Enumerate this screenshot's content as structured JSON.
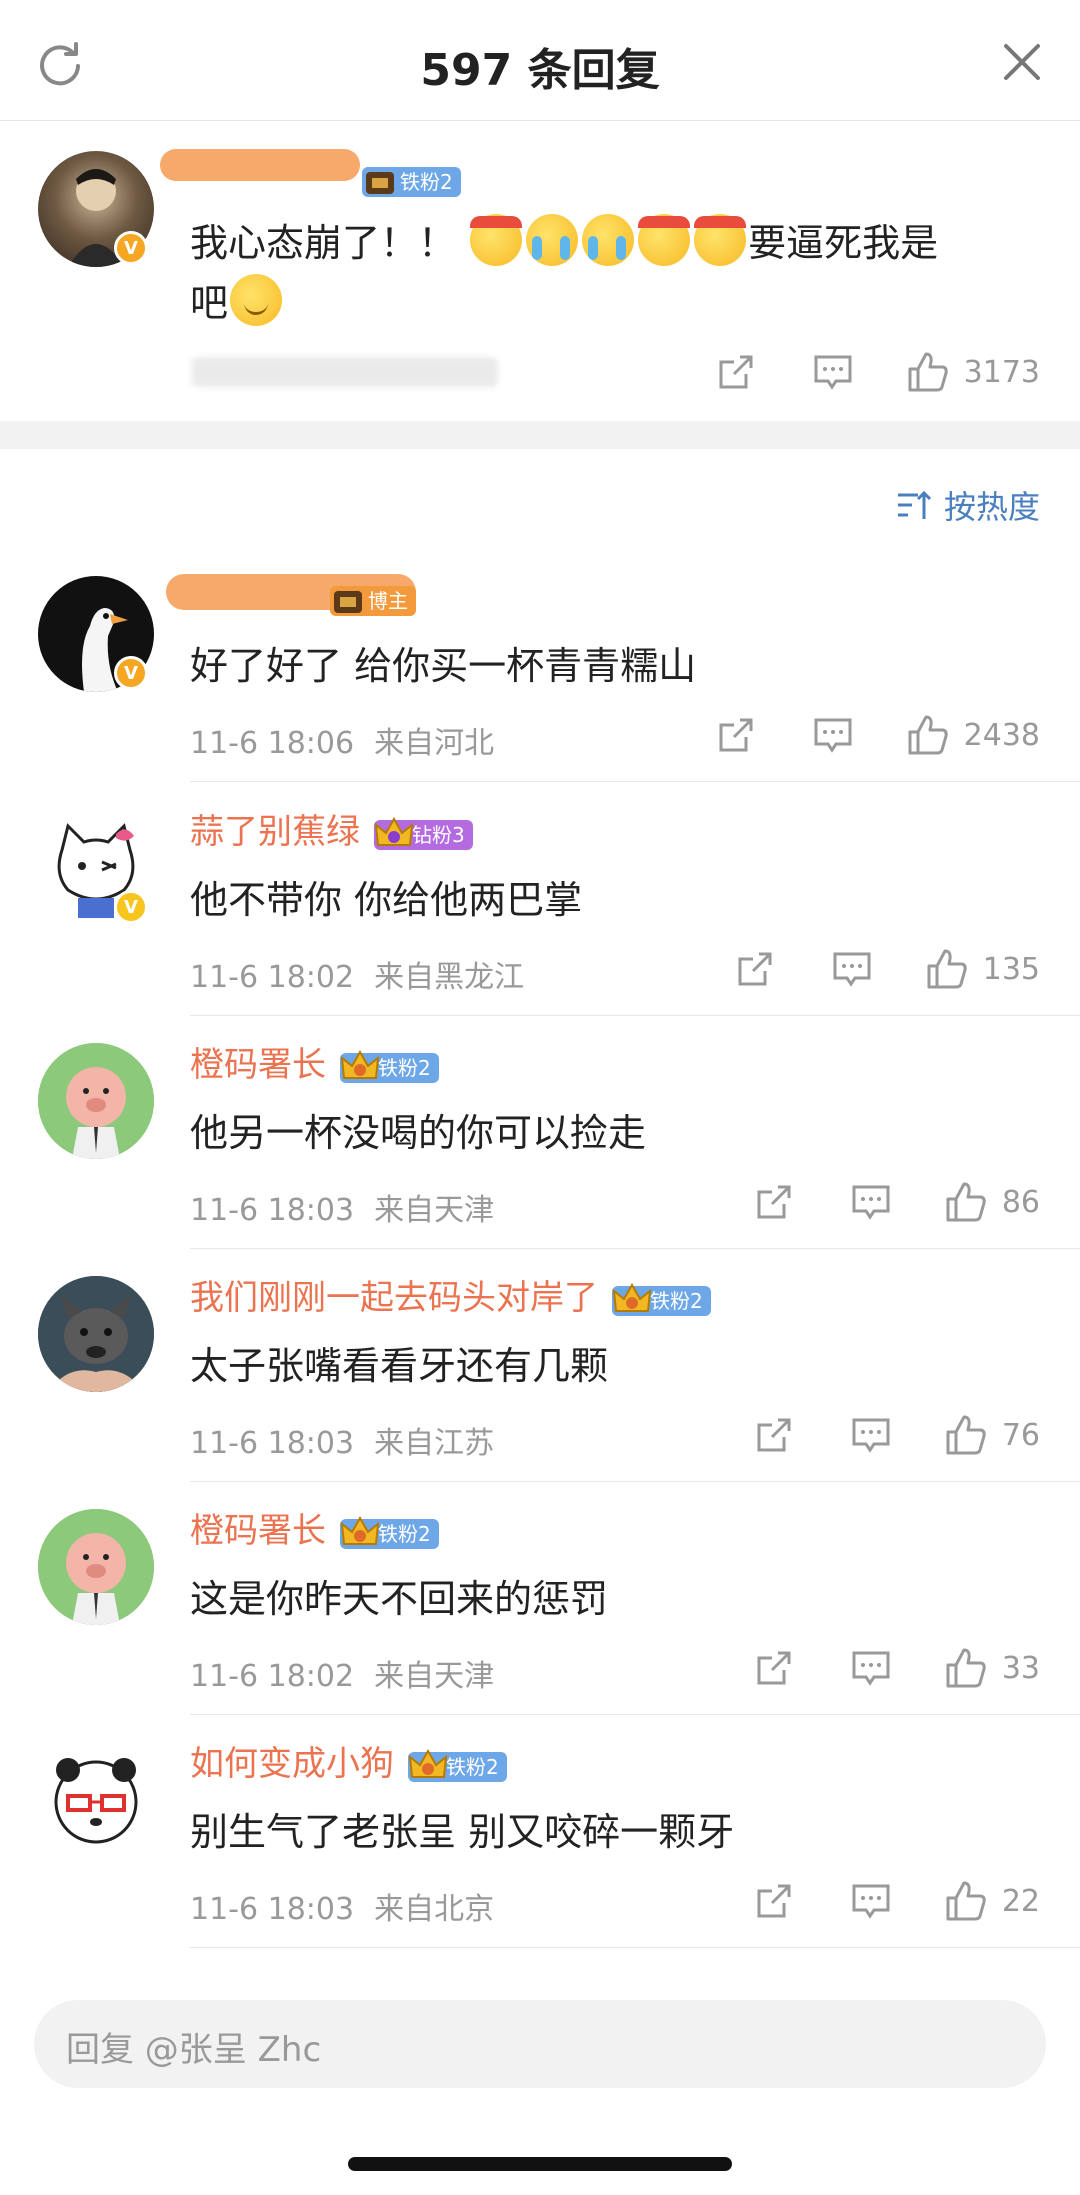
{
  "header": {
    "title": "597 条回复",
    "refresh_icon": "refresh-icon",
    "close_icon": "close-icon"
  },
  "post": {
    "tag": "铁粉2",
    "text_line1": "我心态崩了！！",
    "text_line1b": "要逼死我是",
    "text_line2": "吧",
    "likes": "3173"
  },
  "sort": {
    "label": "按热度"
  },
  "comments": [
    {
      "name": "",
      "tag": "博主",
      "tag_type": "blogger",
      "text": "好了好了 给你买一杯青青糯山",
      "time": "11-6 18:06",
      "location": "来自河北",
      "likes": "2438"
    },
    {
      "name": "蒜了别蕉绿",
      "tag": "钻粉3",
      "tag_type": "diamond",
      "text": "他不带你 你给他两巴掌",
      "time": "11-6 18:02",
      "location": "来自黑龙江",
      "likes": "135"
    },
    {
      "name": "橙码署长",
      "tag": "铁粉2",
      "tag_type": "iron",
      "text": "他另一杯没喝的你可以捡走",
      "time": "11-6 18:03",
      "location": "来自天津",
      "likes": "86"
    },
    {
      "name": "我们刚刚一起去码头对岸了",
      "tag": "铁粉2",
      "tag_type": "iron",
      "text": "太子张嘴看看牙还有几颗",
      "time": "11-6 18:03",
      "location": "来自江苏",
      "likes": "76"
    },
    {
      "name": "橙码署长",
      "tag": "铁粉2",
      "tag_type": "iron",
      "text": "这是你昨天不回来的惩罚",
      "time": "11-6 18:02",
      "location": "来自天津",
      "likes": "33"
    },
    {
      "name": "如何变成小狗",
      "tag": "铁粉2",
      "tag_type": "iron",
      "text": "别生气了老张呈 别又咬碎一颗牙",
      "time": "11-6 18:03",
      "location": "来自北京",
      "likes": "22"
    }
  ],
  "reply": {
    "placeholder": "回复 @张呈 Zhc"
  },
  "colors": {
    "username": "#eb7350",
    "link": "#4a7fbf",
    "meta": "#999999"
  }
}
